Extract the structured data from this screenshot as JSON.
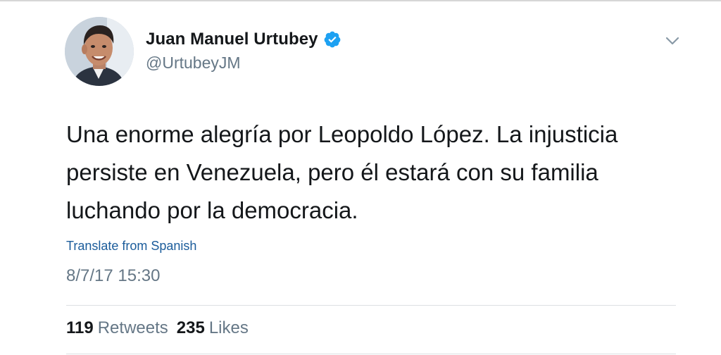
{
  "tweet": {
    "author": {
      "display_name": "Juan Manuel Urtubey",
      "handle": "@UrtubeyJM",
      "verified": true
    },
    "text_lines": [
      "Una enorme alegría por Leopoldo López. La injusticia",
      "persiste en Venezuela, pero él estará con su familia",
      "luchando por la democracia."
    ],
    "translate_label": "Translate from Spanish",
    "timestamp": "8/7/17 15:30",
    "stats": {
      "retweets_count": "119",
      "retweets_label": "Retweets",
      "likes_count": "235",
      "likes_label": "Likes"
    }
  },
  "icons": {
    "verified": "verified-badge-icon",
    "menu": "chevron-down-icon"
  },
  "colors": {
    "verified_blue": "#1da1f2",
    "link_blue": "#1b5c9b",
    "secondary_text": "#657786",
    "primary_text": "#14171a"
  }
}
